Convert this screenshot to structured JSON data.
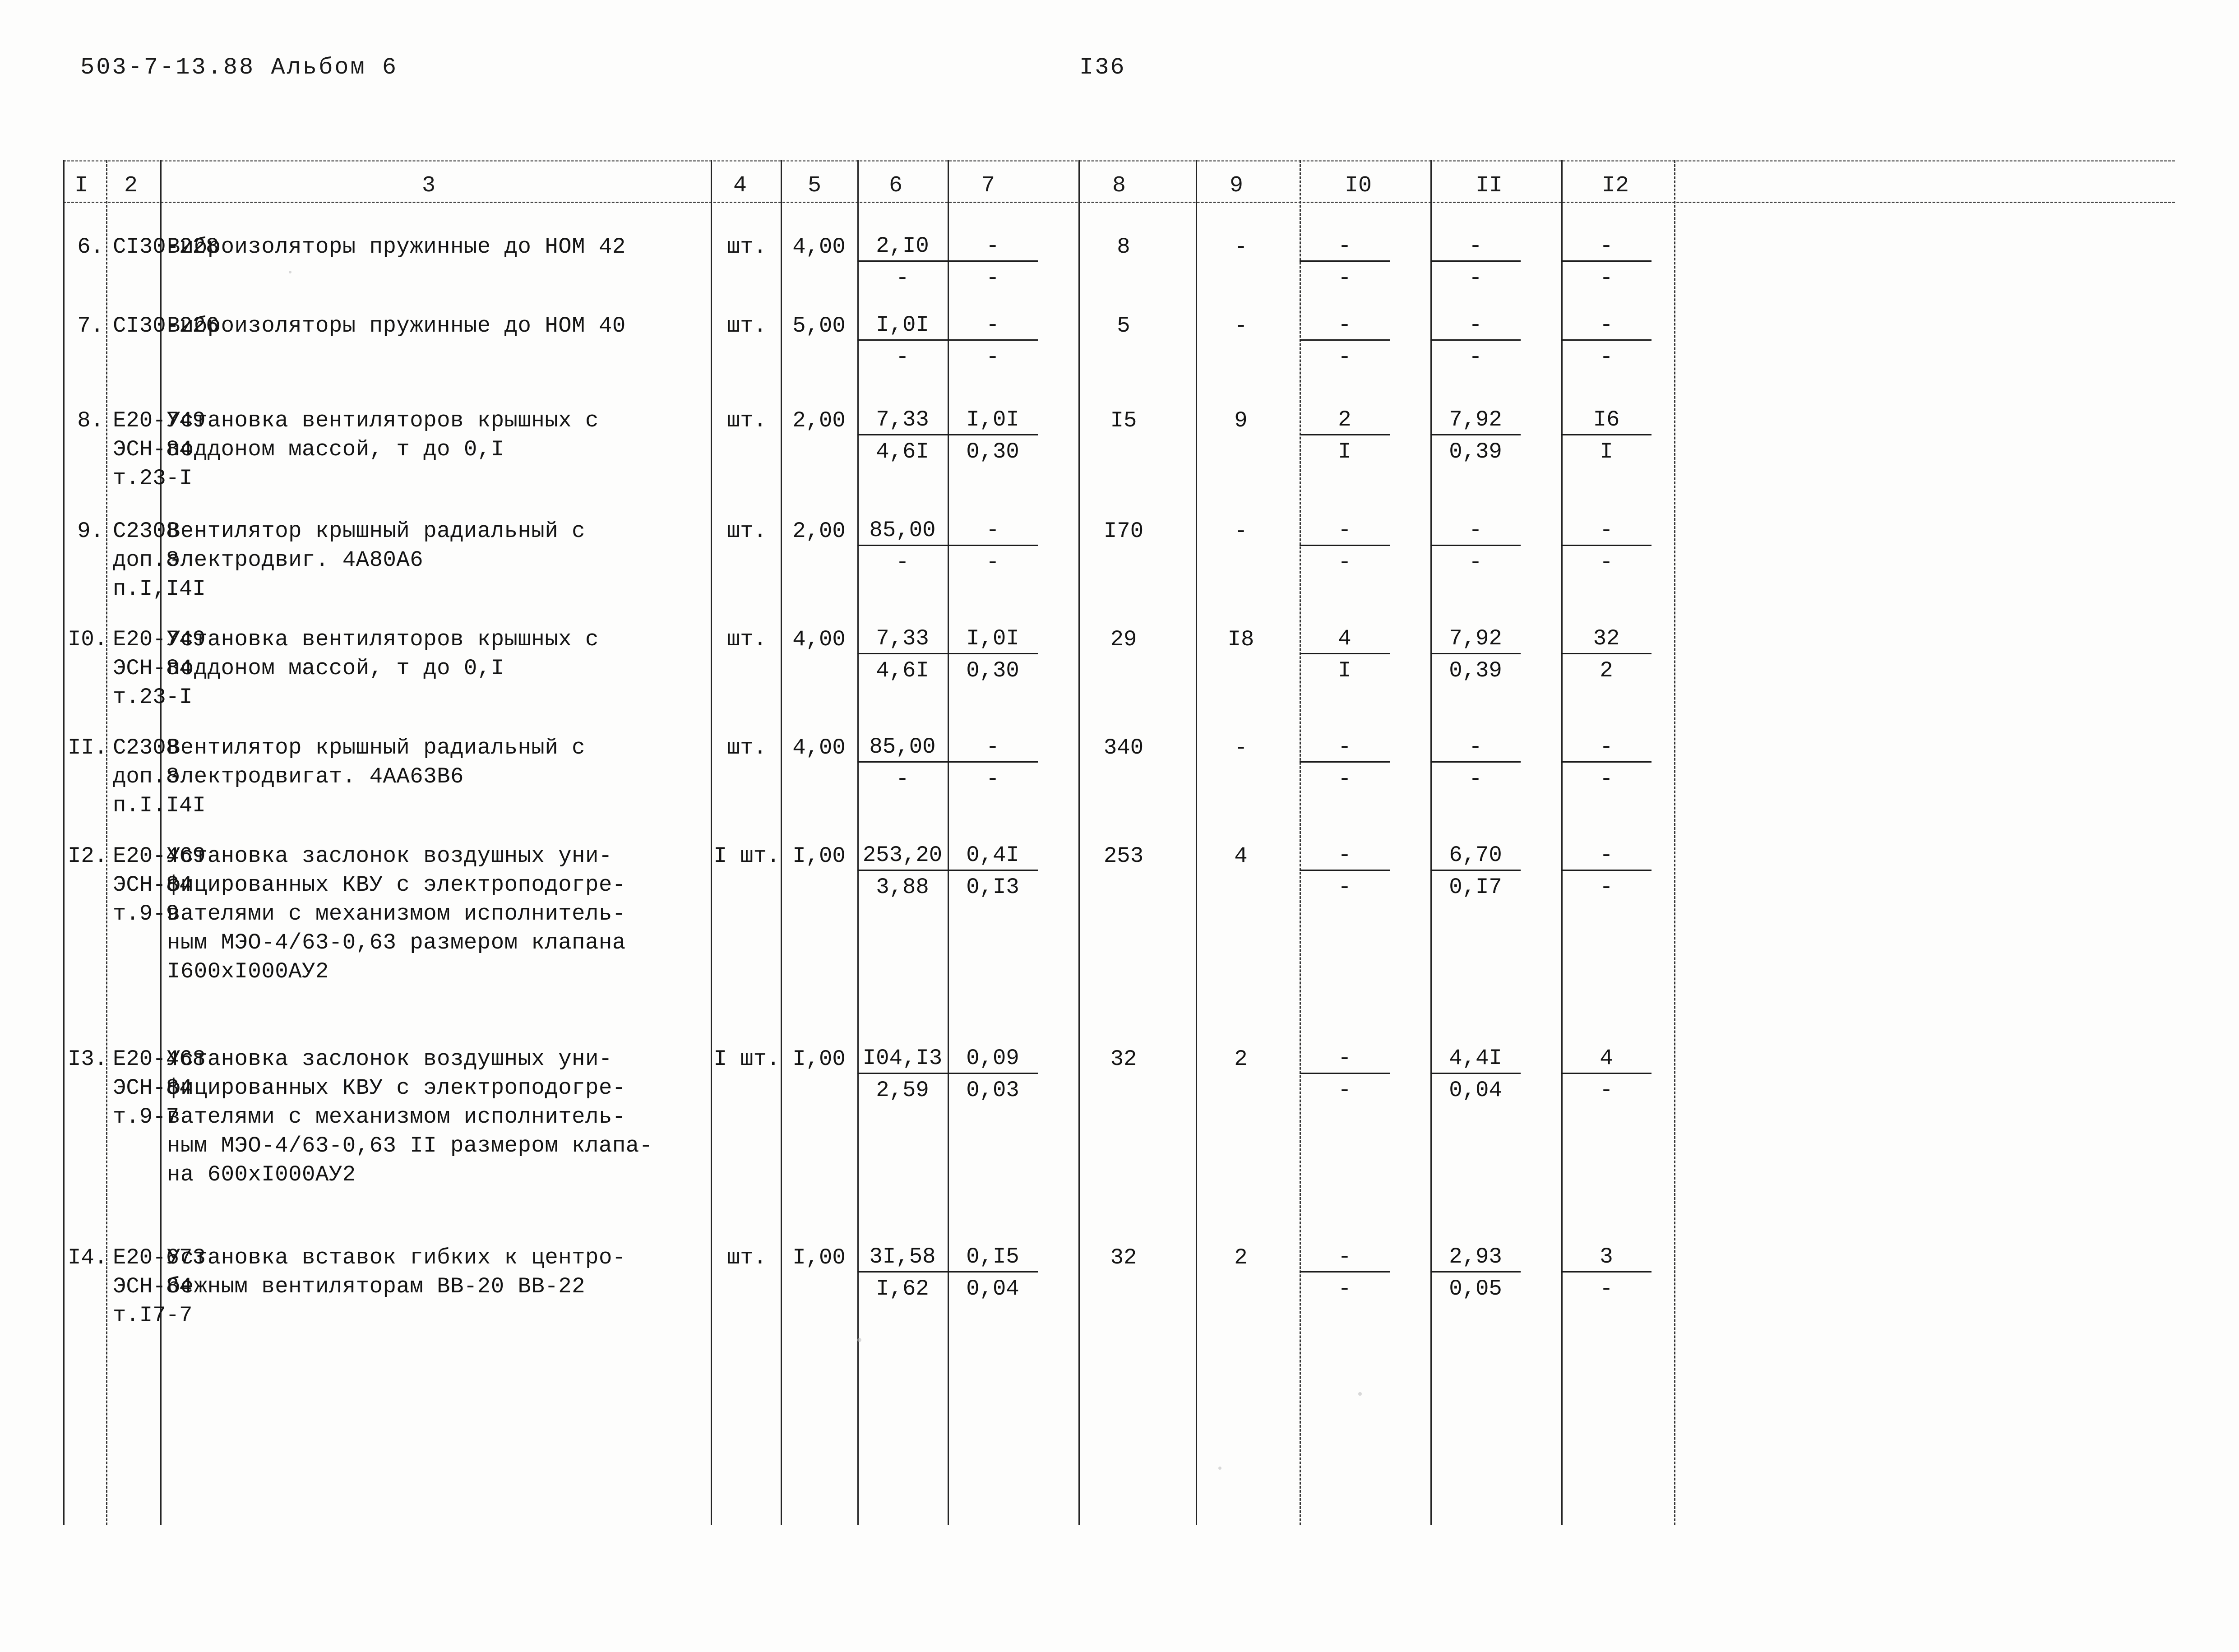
{
  "header": {
    "doc_code": "503-7-13.88  Альбом 6",
    "page_number": "I36"
  },
  "table": {
    "column_headers": [
      "I",
      "2",
      "3",
      "4",
      "5",
      "6",
      "7",
      "8",
      "9",
      "I0",
      "II",
      "I2"
    ],
    "rows": [
      {
        "num": "6.",
        "code": "CI30-228",
        "description": "Виброизоляторы пружинные до HOM 42",
        "unit": "шт.",
        "qty": "4,00",
        "c6_top": "2,I0",
        "c6_bot": "-",
        "c7_top": "-",
        "c7_bot": "-",
        "c8": "8",
        "c9": "-",
        "c10_top": "-",
        "c10_bot": "-",
        "c11_top": "-",
        "c11_bot": "-",
        "c12_top": "-",
        "c12_bot": "-"
      },
      {
        "num": "7.",
        "code": "CI30-226",
        "description": "Виброизоляторы пружинные до HOM 40",
        "unit": "шт.",
        "qty": "5,00",
        "c6_top": "I,0I",
        "c6_bot": "-",
        "c7_top": "-",
        "c7_bot": "-",
        "c8": "5",
        "c9": "-",
        "c10_top": "-",
        "c10_bot": "-",
        "c11_top": "-",
        "c11_bot": "-",
        "c12_top": "-",
        "c12_bot": "-"
      },
      {
        "num": "8.",
        "code": "Е20-749\nЭСН-84\nт.23-I",
        "description": "Установка вентиляторов крышных с\nподдоном массой, т до 0,I",
        "unit": "шт.",
        "qty": "2,00",
        "c6_top": "7,33",
        "c6_bot": "4,6I",
        "c7_top": "I,0I",
        "c7_bot": "0,30",
        "c8": "I5",
        "c9": "9",
        "c10_top": "2",
        "c10_bot": "I",
        "c11_top": "7,92",
        "c11_bot": "0,39",
        "c12_top": "I6",
        "c12_bot": "I"
      },
      {
        "num": "9.",
        "code": "C2308\nдоп.8\nп.I,I4I",
        "description": "Вентилятор крышный радиальный с\nэлектродвиг. 4A80A6",
        "unit": "шт.",
        "qty": "2,00",
        "c6_top": "85,00",
        "c6_bot": "-",
        "c7_top": "-",
        "c7_bot": "-",
        "c8": "I70",
        "c9": "-",
        "c10_top": "-",
        "c10_bot": "-",
        "c11_top": "-",
        "c11_bot": "-",
        "c12_top": "-",
        "c12_bot": "-"
      },
      {
        "num": "I0.",
        "code": "Е20-749\nЭСН-84\nт.23-I",
        "description": "Установка вентиляторов крышных с\nподдоном массой, т до 0,I",
        "unit": "шт.",
        "qty": "4,00",
        "c6_top": "7,33",
        "c6_bot": "4,6I",
        "c7_top": "I,0I",
        "c7_bot": "0,30",
        "c8": "29",
        "c9": "I8",
        "c10_top": "4",
        "c10_bot": "I",
        "c11_top": "7,92",
        "c11_bot": "0,39",
        "c12_top": "32",
        "c12_bot": "2"
      },
      {
        "num": "II.",
        "code": "C2308\nдоп.8\nп.I.I4I",
        "description": "Вентилятор крышный радиальный с\nэлектродвигат. 4AA63B6",
        "unit": "шт.",
        "qty": "4,00",
        "c6_top": "85,00",
        "c6_bot": "-",
        "c7_top": "-",
        "c7_bot": "-",
        "c8": "340",
        "c9": "-",
        "c10_top": "-",
        "c10_bot": "-",
        "c11_top": "-",
        "c11_bot": "-",
        "c12_top": "-",
        "c12_bot": "-"
      },
      {
        "num": "I2.",
        "code": "Е20-469\nЭСН-84\nт.9-9",
        "description": "Установка заслонок воздушных уни-\nфицированных КВУ с электроподогре-\nвателями с механизмом исполнитель-\nным МЭО-4/63-0,63 размером клапана\nI600xI000АУ2",
        "unit": "I шт.",
        "qty": "I,00",
        "c6_top": "253,20",
        "c6_bot": "3,88",
        "c7_top": "0,4I",
        "c7_bot": "0,I3",
        "c8": "253",
        "c9": "4",
        "c10_top": "-",
        "c10_bot": "-",
        "c11_top": "6,70",
        "c11_bot": "0,I7",
        "c12_top": "-",
        "c12_bot": "-"
      },
      {
        "num": "I3.",
        "code": "Е20-468\nЭСН-84\nт.9-7",
        "description": "Установка заслонок воздушных уни-\nфицированных КВУ с электроподогре-\nвателями с механизмом исполнитель-\nным МЭО-4/63-0,63 II размером клапа-\nна 600xI000АУ2",
        "unit": "I шт.",
        "qty": "I,00",
        "c6_top": "I04,I3",
        "c6_bot": "2,59",
        "c7_top": "0,09",
        "c7_bot": "0,03",
        "c8": "32",
        "c9": "2",
        "c10_top": "-",
        "c10_bot": "-",
        "c11_top": "4,4I",
        "c11_bot": "0,04",
        "c12_top": "4",
        "c12_bot": "-"
      },
      {
        "num": "I4.",
        "code": "Е20-673\nЭСН-84\nт.I7-7",
        "description": "Установка вставок гибких к центро-\nбежным вентиляторам ВВ-20 ВВ-22",
        "unit": "шт.",
        "qty": "I,00",
        "c6_top": "3I,58",
        "c6_bot": "I,62",
        "c7_top": "0,I5",
        "c7_bot": "0,04",
        "c8": "32",
        "c9": "2",
        "c10_top": "-",
        "c10_bot": "-",
        "c11_top": "2,93",
        "c11_bot": "0,05",
        "c12_top": "3",
        "c12_bot": "-"
      }
    ]
  }
}
